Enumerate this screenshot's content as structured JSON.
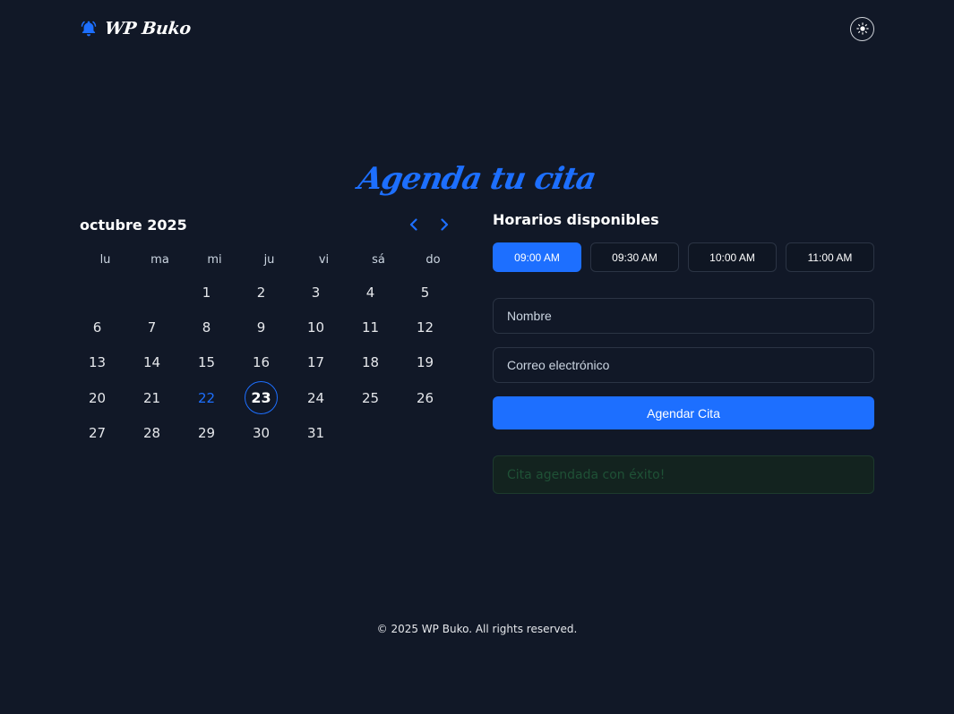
{
  "header": {
    "brand_name": "WP Buko",
    "brand_icon": "bell-icon",
    "theme_toggle_icon": "sun-icon"
  },
  "page_title": "Agenda tu cita",
  "calendar": {
    "month_label": "octubre 2025",
    "prev_icon": "chevron-left-icon",
    "next_icon": "chevron-right-icon",
    "weekdays": [
      "lu",
      "ma",
      "mi",
      "ju",
      "vi",
      "sá",
      "do"
    ],
    "weeks": [
      [
        "",
        "",
        "1",
        "2",
        "3",
        "4",
        "5"
      ],
      [
        "6",
        "7",
        "8",
        "9",
        "10",
        "11",
        "12"
      ],
      [
        "13",
        "14",
        "15",
        "16",
        "17",
        "18",
        "19"
      ],
      [
        "20",
        "21",
        "22",
        "23",
        "24",
        "25",
        "26"
      ],
      [
        "27",
        "28",
        "29",
        "30",
        "31",
        "",
        ""
      ]
    ],
    "today": "22",
    "selected": "23"
  },
  "booking": {
    "title": "Horarios disponibles",
    "slots": [
      "09:00 AM",
      "09:30 AM",
      "10:00 AM",
      "11:00 AM"
    ],
    "active_slot": "09:00 AM",
    "name_placeholder": "Nombre",
    "email_placeholder": "Correo electrónico",
    "submit_label": "Agendar Cita",
    "success_message": "Cita agendada con éxito!"
  },
  "footer": {
    "text": "© 2025 WP Buko. All rights reserved."
  },
  "colors": {
    "background": "#111827",
    "accent": "#1d6fff",
    "success_bg": "#13231f",
    "success_text": "#1f5136"
  }
}
